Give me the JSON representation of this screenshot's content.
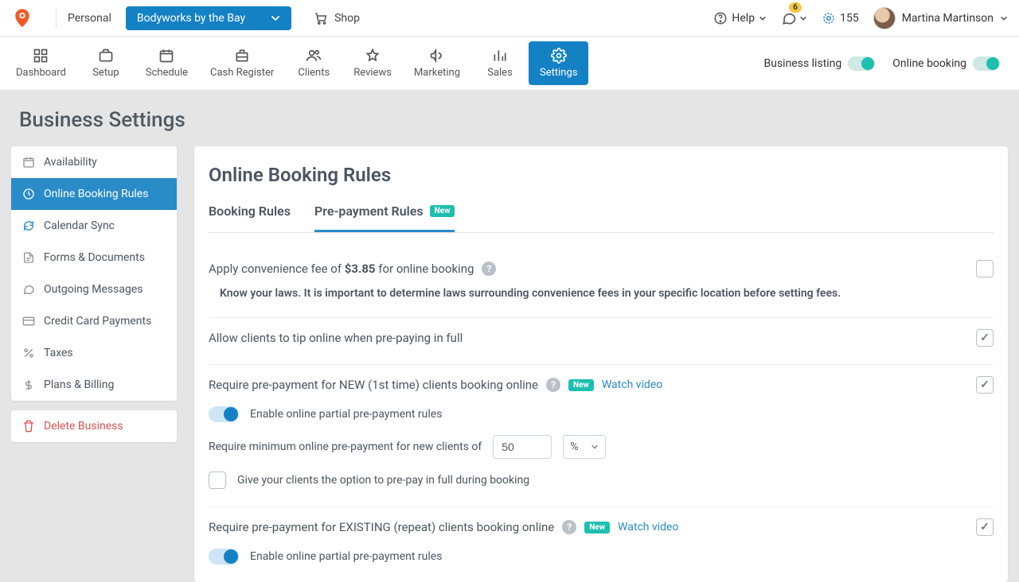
{
  "header": {
    "personal": "Personal",
    "business": "Bodyworks by the Bay",
    "shop": "Shop",
    "help": "Help",
    "notifications": "6",
    "points": "155",
    "user_name": "Martina Martinson"
  },
  "nav": {
    "items": [
      {
        "label": "Dashboard",
        "icon": "grid"
      },
      {
        "label": "Setup",
        "icon": "briefcase"
      },
      {
        "label": "Schedule",
        "icon": "calendar"
      },
      {
        "label": "Cash Register",
        "icon": "register"
      },
      {
        "label": "Clients",
        "icon": "users"
      },
      {
        "label": "Reviews",
        "icon": "star"
      },
      {
        "label": "Marketing",
        "icon": "megaphone"
      },
      {
        "label": "Sales",
        "icon": "chart"
      },
      {
        "label": "Settings",
        "icon": "gear",
        "active": true
      }
    ],
    "toggles": {
      "listing_label": "Business listing",
      "booking_label": "Online booking"
    }
  },
  "page": {
    "title": "Business Settings"
  },
  "sidebar": {
    "items": [
      {
        "label": "Availability",
        "icon": "calendar"
      },
      {
        "label": "Online Booking Rules",
        "icon": "clock",
        "active": true
      },
      {
        "label": "Calendar Sync",
        "icon": "sync"
      },
      {
        "label": "Forms & Documents",
        "icon": "doc"
      },
      {
        "label": "Outgoing Messages",
        "icon": "chat"
      },
      {
        "label": "Credit Card Payments",
        "icon": "card"
      },
      {
        "label": "Taxes",
        "icon": "percent"
      },
      {
        "label": "Plans & Billing",
        "icon": "dollar"
      }
    ],
    "delete_label": "Delete Business"
  },
  "main": {
    "title": "Online Booking Rules",
    "tabs": {
      "booking": "Booking Rules",
      "prepay": "Pre-payment Rules",
      "new_badge": "New"
    },
    "fee": {
      "prefix": "Apply convenience fee of ",
      "amount": "$3.85",
      "suffix": " for online booking",
      "note": "Know your laws. It is important to determine laws surrounding convenience fees in your specific location before setting fees.",
      "checked": false
    },
    "tip": {
      "label": "Allow clients to tip online when pre-paying in full",
      "checked": true
    },
    "new_clients": {
      "label": "Require pre-payment for NEW (1st time) clients booking online",
      "badge": "New",
      "link": "Watch video",
      "checked": true,
      "partial_label": "Enable online partial pre-payment rules",
      "min_label": "Require minimum online pre-payment for new clients of",
      "min_value": "50",
      "min_unit": "%",
      "full_option_label": "Give your clients the option to pre-pay in full during booking"
    },
    "existing_clients": {
      "label": "Require pre-payment for EXISTING (repeat) clients booking online",
      "badge": "New",
      "link": "Watch video",
      "checked": true,
      "partial_label": "Enable online partial pre-payment rules"
    }
  }
}
